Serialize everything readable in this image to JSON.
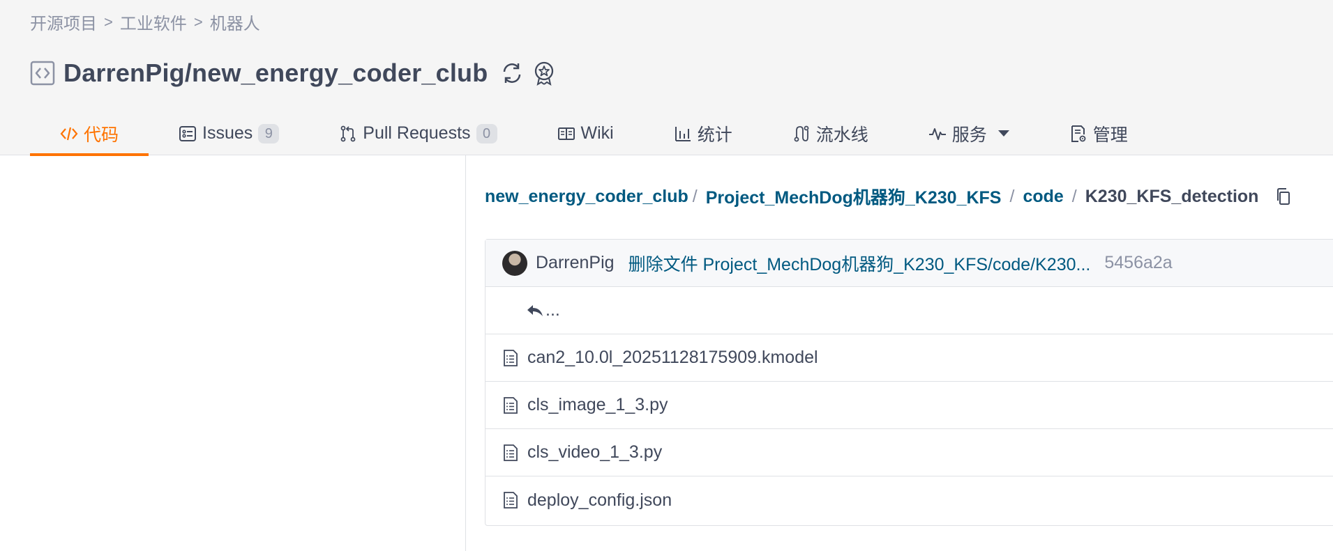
{
  "breadcrumb": {
    "items": [
      "开源项目",
      "工业软件",
      "机器人"
    ],
    "separator": ">"
  },
  "repo": {
    "full_name": "DarrenPig/new_energy_coder_club"
  },
  "tabs": [
    {
      "label": "代码",
      "icon": "code-icon",
      "active": true
    },
    {
      "label": "Issues",
      "icon": "issues-icon",
      "count": "9"
    },
    {
      "label": "Pull Requests",
      "icon": "pull-request-icon",
      "count": "0"
    },
    {
      "label": "Wiki",
      "icon": "wiki-book-icon"
    },
    {
      "label": "统计",
      "icon": "bar-chart-icon"
    },
    {
      "label": "流水线",
      "icon": "pipeline-icon"
    },
    {
      "label": "服务",
      "icon": "pulse-icon",
      "dropdown": true
    },
    {
      "label": "管理",
      "icon": "settings-doc-icon"
    }
  ],
  "path": {
    "segments": [
      "new_energy_coder_club",
      "Project_MechDog机器狗_K230_KFS",
      "code",
      "K230_KFS_detection"
    ],
    "separator": "/"
  },
  "commit": {
    "author": "DarrenPig",
    "message": "删除文件 Project_MechDog机器狗_K230_KFS/code/K230...",
    "sha": "5456a2a"
  },
  "parent_label": "...",
  "files": [
    {
      "name": "can2_10.0l_20251128175909.kmodel",
      "icon": "file-icon"
    },
    {
      "name": "cls_image_1_3.py",
      "icon": "file-icon"
    },
    {
      "name": "cls_video_1_3.py",
      "icon": "file-icon"
    },
    {
      "name": "deploy_config.json",
      "icon": "file-icon"
    }
  ],
  "colors": {
    "accent": "#fe7300",
    "link": "#005980",
    "text": "#40485b",
    "muted": "#8c92a4"
  }
}
